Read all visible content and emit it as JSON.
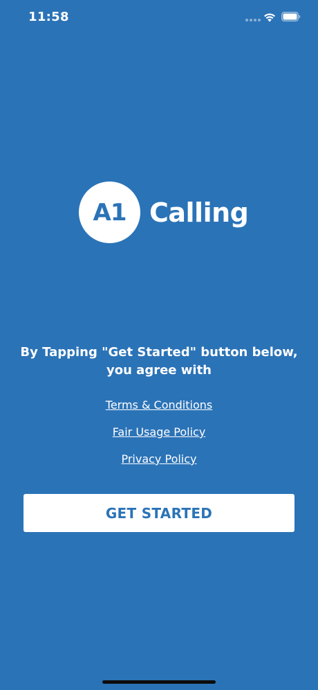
{
  "status_bar": {
    "time": "11:58"
  },
  "logo": {
    "mark": "A1",
    "word": "Calling"
  },
  "consent": {
    "text": "By Tapping \"Get Started\" button below, you agree with",
    "links": {
      "terms": "Terms & Conditions",
      "fair_usage": "Fair Usage Policy",
      "privacy": "Privacy Policy"
    }
  },
  "actions": {
    "get_started": "GET STARTED"
  },
  "colors": {
    "background": "#2b73b7",
    "button": "#ffffff",
    "button_text": "#2b73b7"
  },
  "icons": {
    "wifi": "wifi-icon",
    "battery": "battery-icon",
    "signal": "cellular-signal-icon"
  }
}
